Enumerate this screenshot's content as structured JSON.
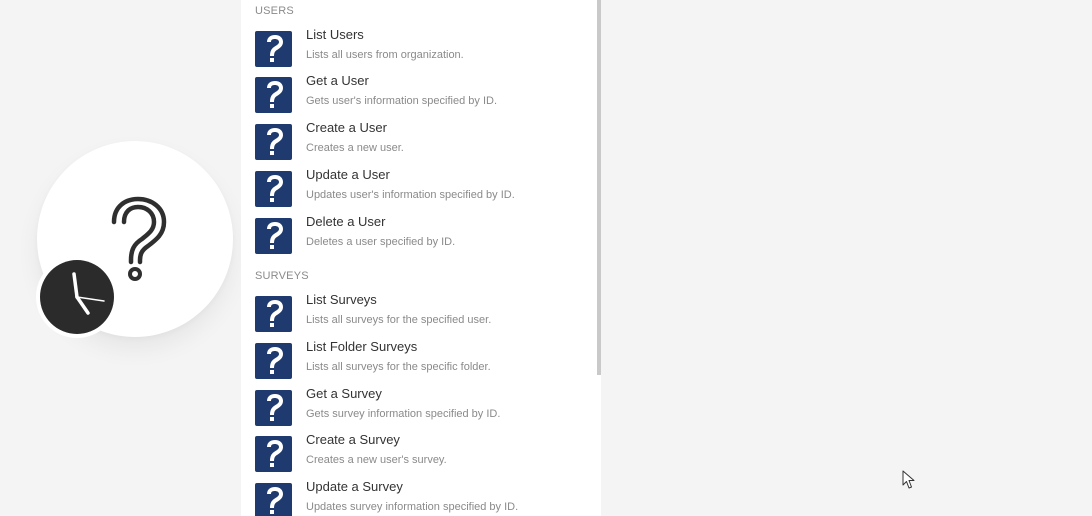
{
  "sections": [
    {
      "label": "USERS",
      "items": [
        {
          "title": "List Users",
          "desc": "Lists all users from organization."
        },
        {
          "title": "Get a User",
          "desc": "Gets user's information specified by ID."
        },
        {
          "title": "Create a User",
          "desc": "Creates a new user."
        },
        {
          "title": "Update a User",
          "desc": "Updates user's information specified by ID."
        },
        {
          "title": "Delete a User",
          "desc": "Deletes a user specified by ID."
        }
      ]
    },
    {
      "label": "SURVEYS",
      "items": [
        {
          "title": "List Surveys",
          "desc": "Lists all surveys for the specified user."
        },
        {
          "title": "List Folder Surveys",
          "desc": "Lists all surveys for the specific folder."
        },
        {
          "title": "Get a Survey",
          "desc": "Gets survey information specified by ID."
        },
        {
          "title": "Create a Survey",
          "desc": "Creates a new user's survey."
        },
        {
          "title": "Update a Survey",
          "desc": "Updates survey information specified by ID."
        }
      ]
    }
  ],
  "icons": {
    "module": "question-mark-icon",
    "trigger": "clock-icon",
    "item": "question-mark-icon"
  },
  "colors": {
    "item_icon_bg": "#1f3a6e",
    "background": "#f4f4f4",
    "panel": "#ffffff"
  }
}
